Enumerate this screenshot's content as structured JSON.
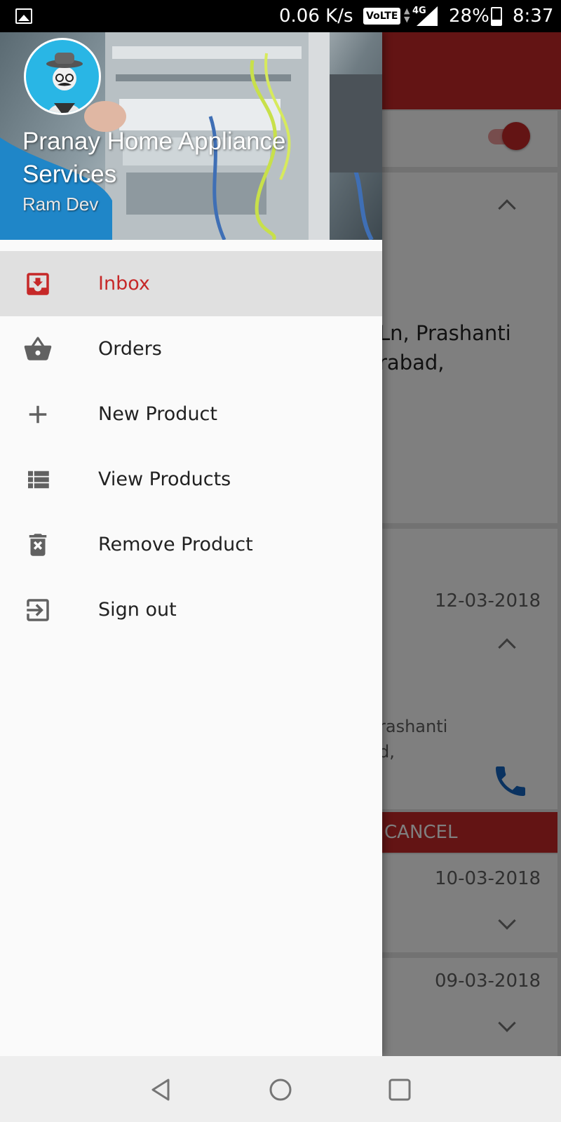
{
  "status_bar": {
    "network_speed": "0.06 K/s",
    "volte_label": "VoLTE",
    "network_type": "4G",
    "battery": "28%",
    "time": "8:37"
  },
  "drawer": {
    "title": "Pranay Home Appliance Services",
    "subtitle": "Ram Dev",
    "items": [
      {
        "label": "Inbox",
        "icon": "inbox-icon",
        "active": true
      },
      {
        "label": "Orders",
        "icon": "basket-icon"
      },
      {
        "label": "New Product",
        "icon": "plus-icon"
      },
      {
        "label": "View Products",
        "icon": "list-icon"
      },
      {
        "label": "Remove Product",
        "icon": "delete-icon"
      },
      {
        "label": "Sign out",
        "icon": "exit-icon"
      }
    ]
  },
  "background": {
    "address_line_1": "Ln, Prashanti",
    "address_line_2": "rabad,",
    "orders": [
      {
        "date": "12-03-2018",
        "address_line_1": "rashanti",
        "address_line_2": "d,"
      },
      {
        "date": "10-03-2018"
      },
      {
        "date": "09-03-2018"
      }
    ],
    "cancel_label": "CANCEL"
  },
  "colors": {
    "accent": "#c62828",
    "drawer_background": "#fafafa",
    "active_item_background": "#e0e0e0",
    "avatar_background": "#29b6e5"
  }
}
